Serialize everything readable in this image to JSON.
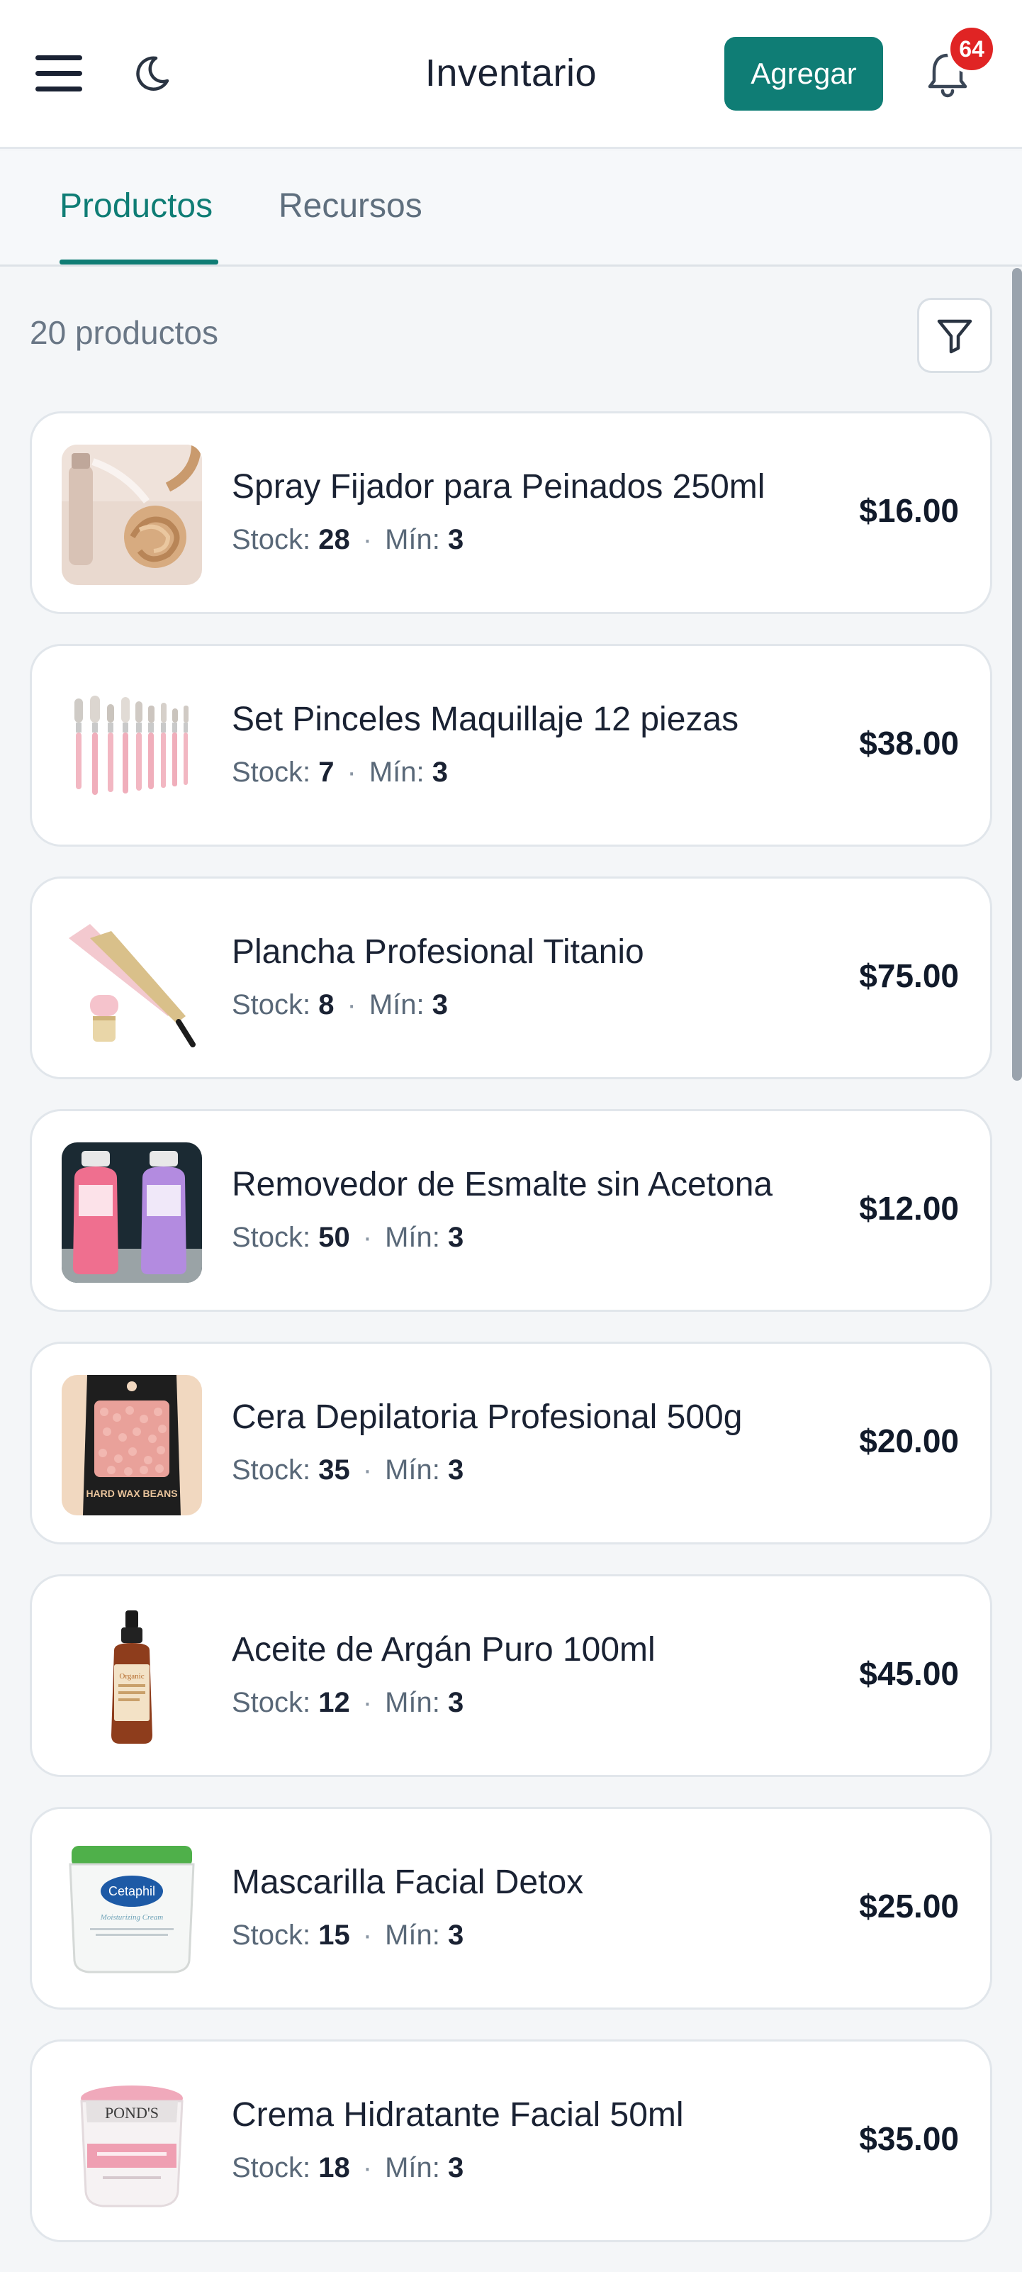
{
  "header": {
    "title": "Inventario",
    "add_label": "Agregar",
    "notification_count": "64",
    "icons": [
      "menu-icon",
      "moon-icon",
      "bell-icon"
    ]
  },
  "tabs": [
    {
      "label": "Productos",
      "active": true
    },
    {
      "label": "Recursos",
      "active": false
    }
  ],
  "list_info": {
    "count_label": "20 productos",
    "filter_icon": "filter-icon"
  },
  "labels": {
    "stock": "Stock:",
    "min": "Mín:",
    "sep": "·"
  },
  "products": [
    {
      "name": "Spray Fijador para Peinados 250ml",
      "stock": "28",
      "min": "3",
      "price": "$16.00",
      "image": "hair-spray"
    },
    {
      "name": "Set Pinceles Maquillaje 12 piezas",
      "stock": "7",
      "min": "3",
      "price": "$38.00",
      "image": "makeup-brushes"
    },
    {
      "name": "Plancha Profesional Titanio",
      "stock": "8",
      "min": "3",
      "price": "$75.00",
      "image": "flat-iron"
    },
    {
      "name": "Removedor de Esmalte sin Acetona",
      "stock": "50",
      "min": "3",
      "price": "$12.00",
      "image": "nail-polish-remover"
    },
    {
      "name": "Cera Depilatoria Profesional 500g",
      "stock": "35",
      "min": "3",
      "price": "$20.00",
      "image": "wax-beans"
    },
    {
      "name": "Aceite de Argán Puro 100ml",
      "stock": "12",
      "min": "3",
      "price": "$45.00",
      "image": "argan-oil"
    },
    {
      "name": "Mascarilla Facial Detox",
      "stock": "15",
      "min": "3",
      "price": "$25.00",
      "image": "face-mask-jar"
    },
    {
      "name": "Crema Hidratante Facial 50ml",
      "stock": "18",
      "min": "3",
      "price": "$35.00",
      "image": "face-cream-jar"
    }
  ],
  "colors": {
    "accent": "#0f7d75",
    "badge": "#e02424",
    "background": "#f4f6f8"
  },
  "thumb_text": {
    "wax_brand": "HARD WAX BEANS",
    "oil_brand": "Organic",
    "mask_brand": "Cetaphil",
    "mask_sub": "Moisturizing Cream",
    "cream_brand": "POND'S"
  }
}
